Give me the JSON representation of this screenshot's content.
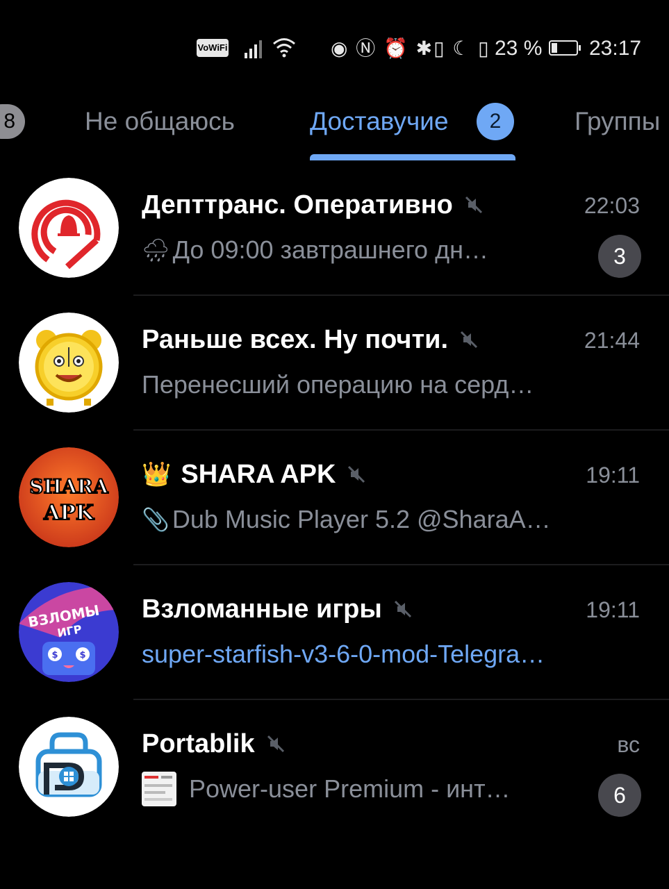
{
  "status_bar": {
    "vowifi": "VoWiFi",
    "icons": "◉ Ⓝ ⏰ ✱▯ ☾ ▯",
    "battery_percent": "23 %",
    "battery_level": 0.23,
    "time": "23:17"
  },
  "tabs": {
    "left_badge": "8",
    "items": [
      {
        "label": "Не общаюсь"
      },
      {
        "label": "Доставучие",
        "badge": "2"
      },
      {
        "label": "Группы"
      }
    ],
    "active": 1
  },
  "chats": [
    {
      "title": "Депттранс. Оперативно",
      "time": "22:03",
      "preview_icon": "🌧",
      "preview": "До 09:00 завтрашнего дн…",
      "unread": "3",
      "muted": true,
      "avatar": "bell-logo"
    },
    {
      "title": "Раньше всех. Ну почти.",
      "time": "21:44",
      "preview": "Перенесший операцию на серд…",
      "muted": true,
      "avatar": "alarm-clock"
    },
    {
      "title_prefix": "👑",
      "title": "SHARA APK",
      "time": "19:11",
      "preview_icon": "📎",
      "preview": "Dub Music Player 5.2 @SharaA…",
      "muted": true,
      "avatar": "shara-apk-logo",
      "avatar_text_1": "SHARA",
      "avatar_text_2": "APK"
    },
    {
      "title": "Взломанные игры",
      "time": "19:11",
      "preview": "super-starfish-v3-6-0-mod-Telegra…",
      "muted": true,
      "avatar": "hacked-games-logo",
      "avatar_text_1": "ВЗЛОМЫ",
      "avatar_text_2": "ИГР"
    },
    {
      "title": "Portablik",
      "time": "вс",
      "preview": "Power-user Premium - инт…",
      "unread": "6",
      "muted": true,
      "avatar": "portablik-logo"
    }
  ],
  "colors": {
    "background": "#000000",
    "accent": "#6fa8f5",
    "secondary_text": "#8a8f99",
    "badge_muted": "#48484e"
  }
}
